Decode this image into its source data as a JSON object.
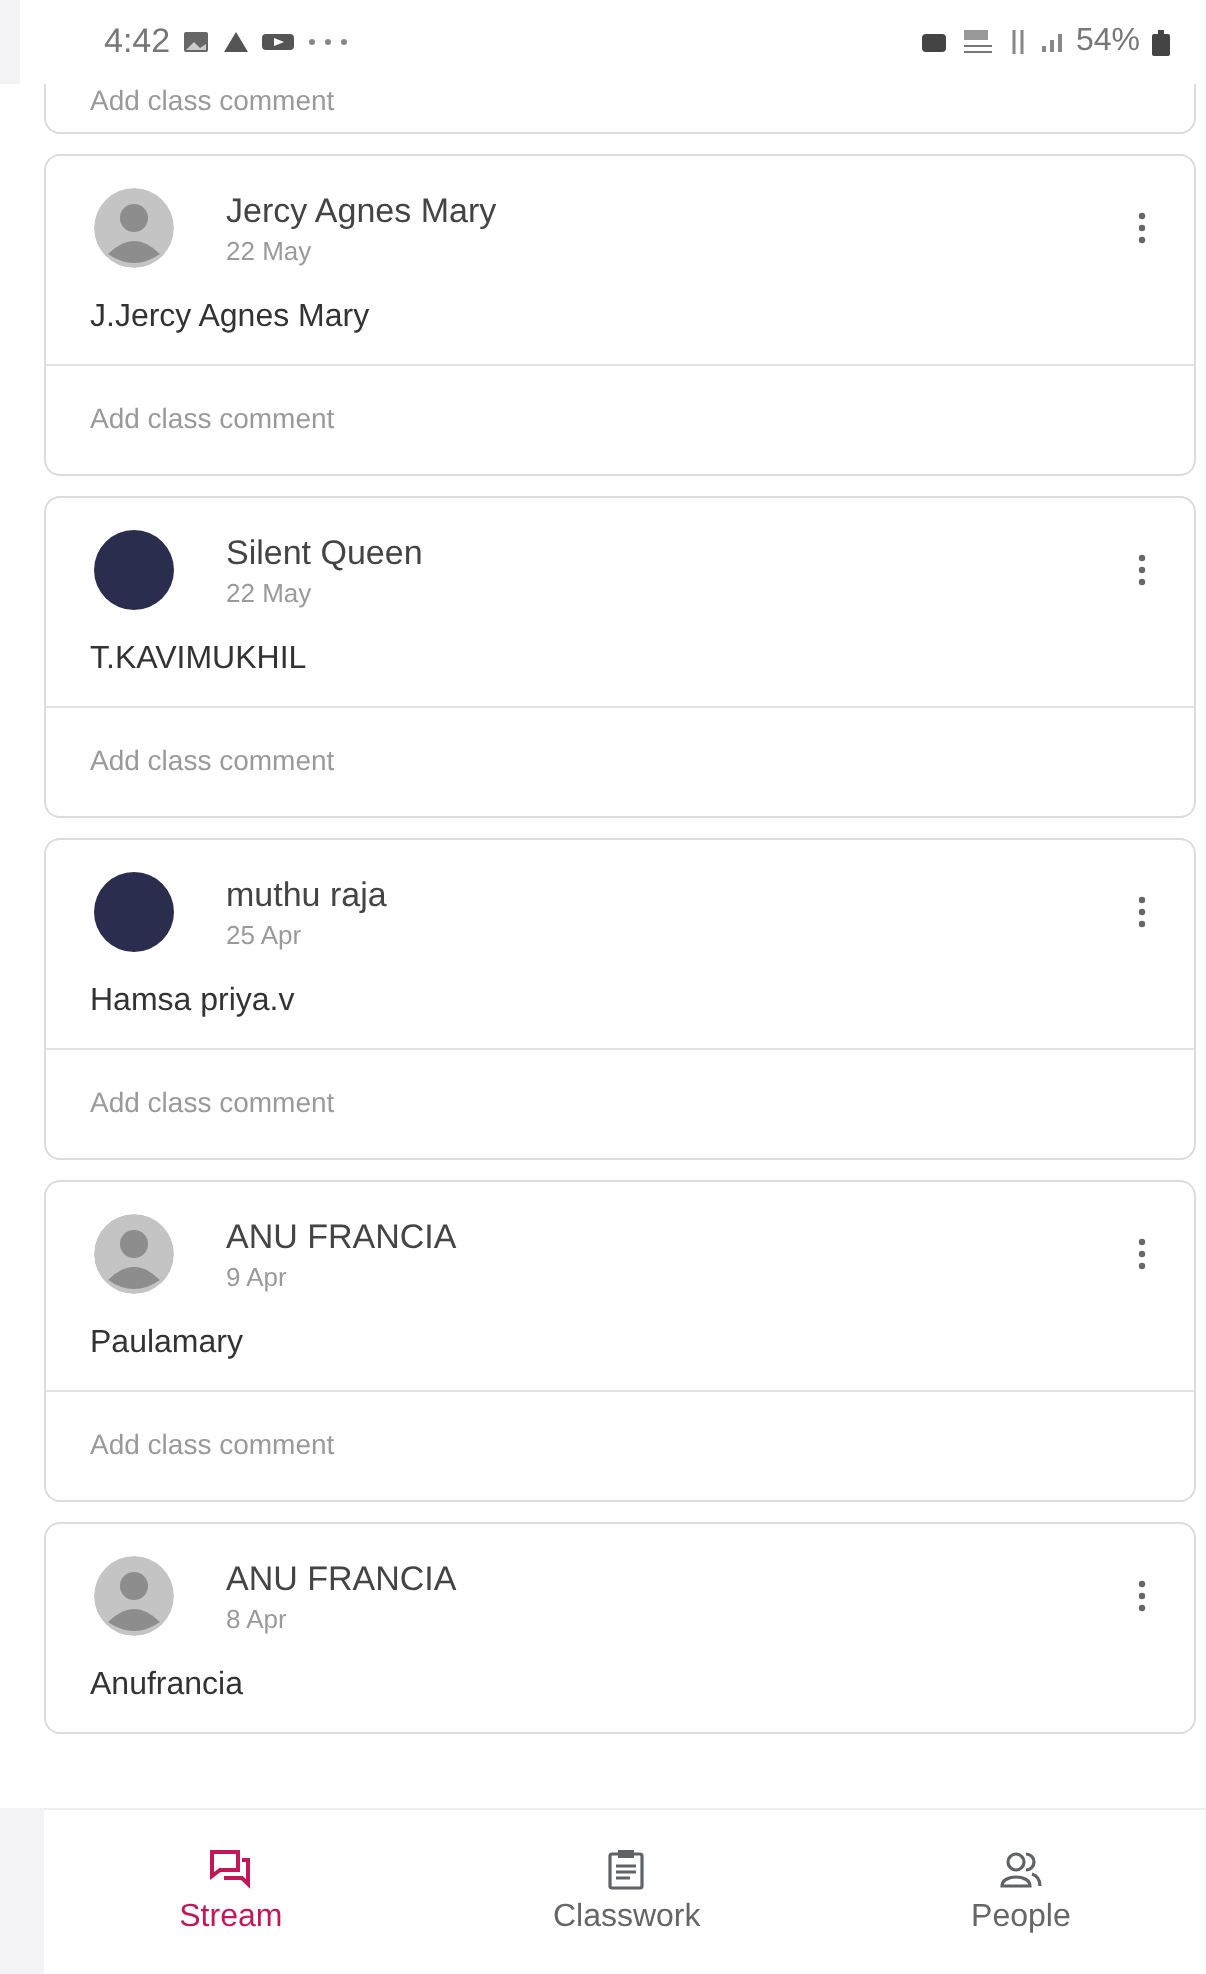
{
  "status_bar": {
    "time": "4:42",
    "battery": "54%"
  },
  "top_comment": {
    "prompt": "Add class comment"
  },
  "posts": [
    {
      "author": "Jercy Agnes Mary",
      "date": "22 May",
      "text": "J.Jercy Agnes Mary",
      "kind": "default",
      "comment_prompt": "Add class comment"
    },
    {
      "author": "Silent Queen",
      "date": "22 May",
      "text": "T.KAVIMUKHIL",
      "kind": "photo",
      "comment_prompt": "Add class comment"
    },
    {
      "author": "muthu raja",
      "date": "25 Apr",
      "text": "Hamsa priya.v",
      "kind": "photo",
      "comment_prompt": "Add class comment"
    },
    {
      "author": "ANU FRANCIA",
      "date": "9 Apr",
      "text": "Paulamary",
      "kind": "default",
      "comment_prompt": "Add class comment"
    },
    {
      "author": "ANU FRANCIA",
      "date": "8 Apr",
      "text": "Anufrancia",
      "kind": "default"
    }
  ],
  "bottom_nav": [
    {
      "kind": "stream",
      "label": "Stream",
      "selected": true
    },
    {
      "kind": "classwork",
      "label": "Classwork",
      "selected": false
    },
    {
      "kind": "people",
      "label": "People",
      "selected": false
    }
  ]
}
